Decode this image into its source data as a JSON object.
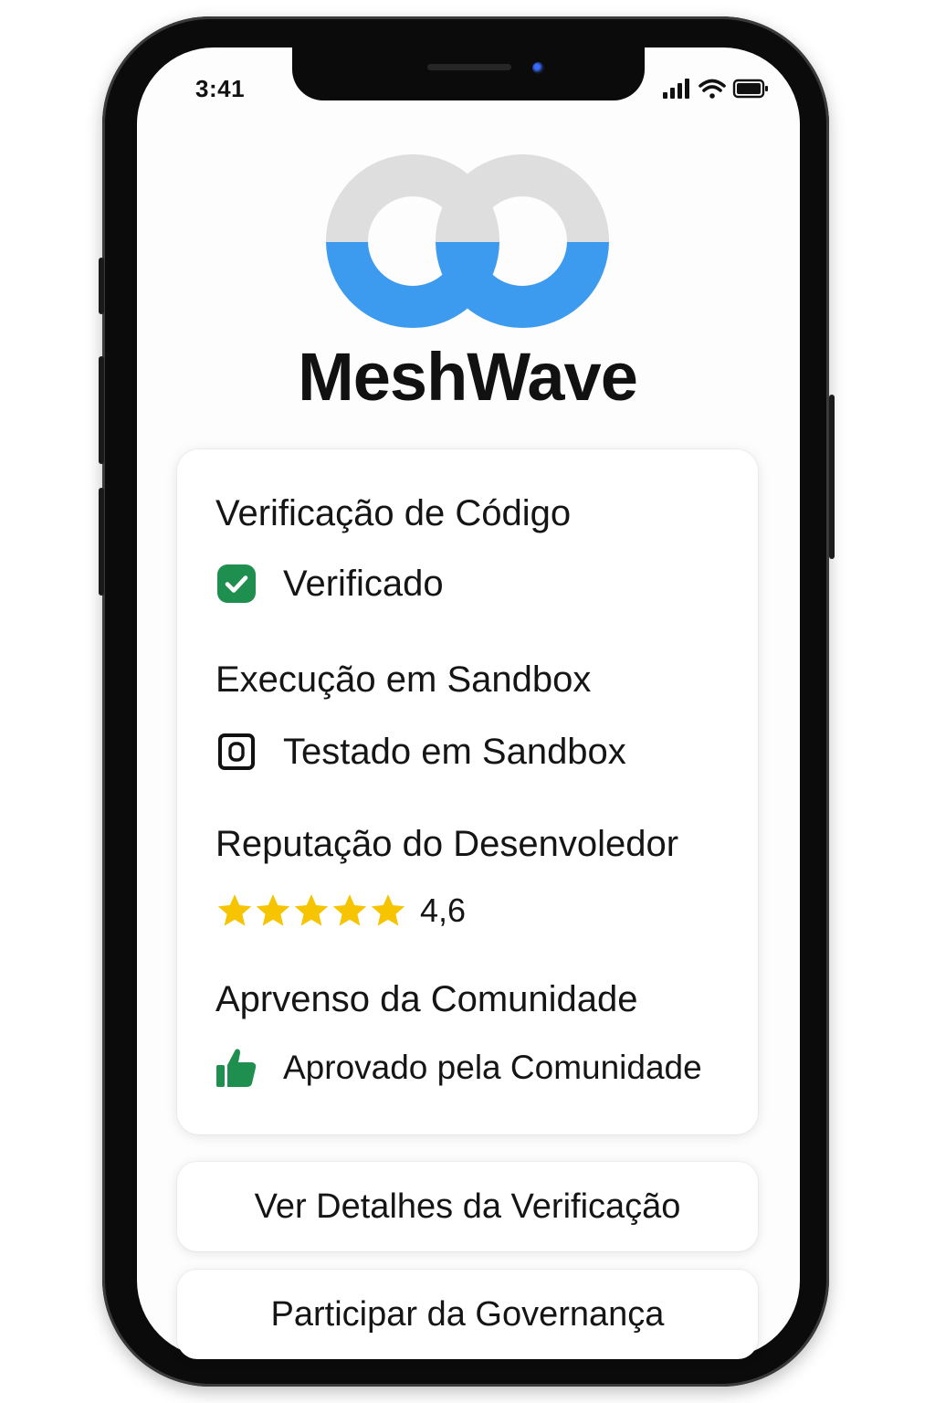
{
  "status_bar": {
    "time": "3:41",
    "icons": [
      "cellular-signal-icon",
      "wifi-icon",
      "battery-icon"
    ]
  },
  "brand": {
    "name": "MeshWave",
    "logo_icon": "interlocking-rings-logo",
    "colors": {
      "logo_top": "#dedede",
      "logo_bottom": "#3d9bef"
    }
  },
  "card": {
    "sections": [
      {
        "title": "Verificação de Código",
        "value": "Verificado",
        "icon": "check-badge-icon",
        "icon_color": "#1e8f4e"
      },
      {
        "title": "Execução em Sandbox",
        "value": "Testado em Sandbox",
        "icon": "sandbox-box-icon"
      },
      {
        "title": "Reputação do Desenvoledor",
        "rating_value": "4,6",
        "stars": 5,
        "star_color": "#f6c400"
      },
      {
        "title": "Aprvenso da Comunidade",
        "value": "Aprovado pela Comunidade",
        "icon": "thumbs-up-icon",
        "icon_color": "#1e8f4e"
      }
    ]
  },
  "actions": {
    "details_label": "Ver Detalhes da Verificação",
    "governance_label": "Participar da Governança"
  }
}
